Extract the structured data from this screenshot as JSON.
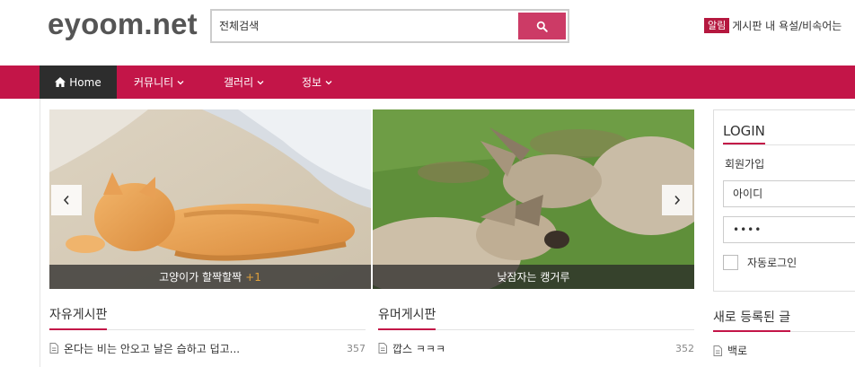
{
  "header": {
    "logo": "eyoom.net",
    "search": {
      "value": "전체검색",
      "button_icon": "search-icon"
    },
    "notice": {
      "badge": "알림",
      "text": "게시판 내 욕설/비속어는"
    }
  },
  "nav": {
    "items": [
      {
        "label": "Home",
        "icon": "home-icon"
      },
      {
        "label": "커뮤니티",
        "icon": "chevron-down-icon"
      },
      {
        "label": "갤러리",
        "icon": "chevron-down-icon"
      },
      {
        "label": "정보",
        "icon": "chevron-down-icon"
      }
    ]
  },
  "slider": {
    "slides": [
      {
        "caption": "고양이가 할짝할짝",
        "extra": "+1"
      },
      {
        "caption": "낮잠자는 캥거루"
      }
    ],
    "prev_icon": "chevron-left-icon",
    "next_icon": "chevron-right-icon"
  },
  "boards": [
    {
      "title": "자유게시판",
      "rows": [
        {
          "title": "온다는 비는 안오고 날은 습하고 덥고...",
          "count": "357"
        }
      ]
    },
    {
      "title": "유머게시판",
      "rows": [
        {
          "title": "깝스 ㅋㅋㅋ",
          "count": "352"
        }
      ]
    }
  ],
  "login": {
    "title": "LOGIN",
    "signup": "회원가입",
    "id_placeholder": "아이디",
    "password_value": "••••",
    "remember_label": "자동로그인"
  },
  "recent": {
    "title": "새로 등록된 글",
    "items": [
      {
        "title": "백로"
      }
    ]
  },
  "colors": {
    "accent": "#c31548",
    "search_button": "#cc3b66",
    "home_bg": "#2d2d2d",
    "badge": "#b5183f"
  }
}
